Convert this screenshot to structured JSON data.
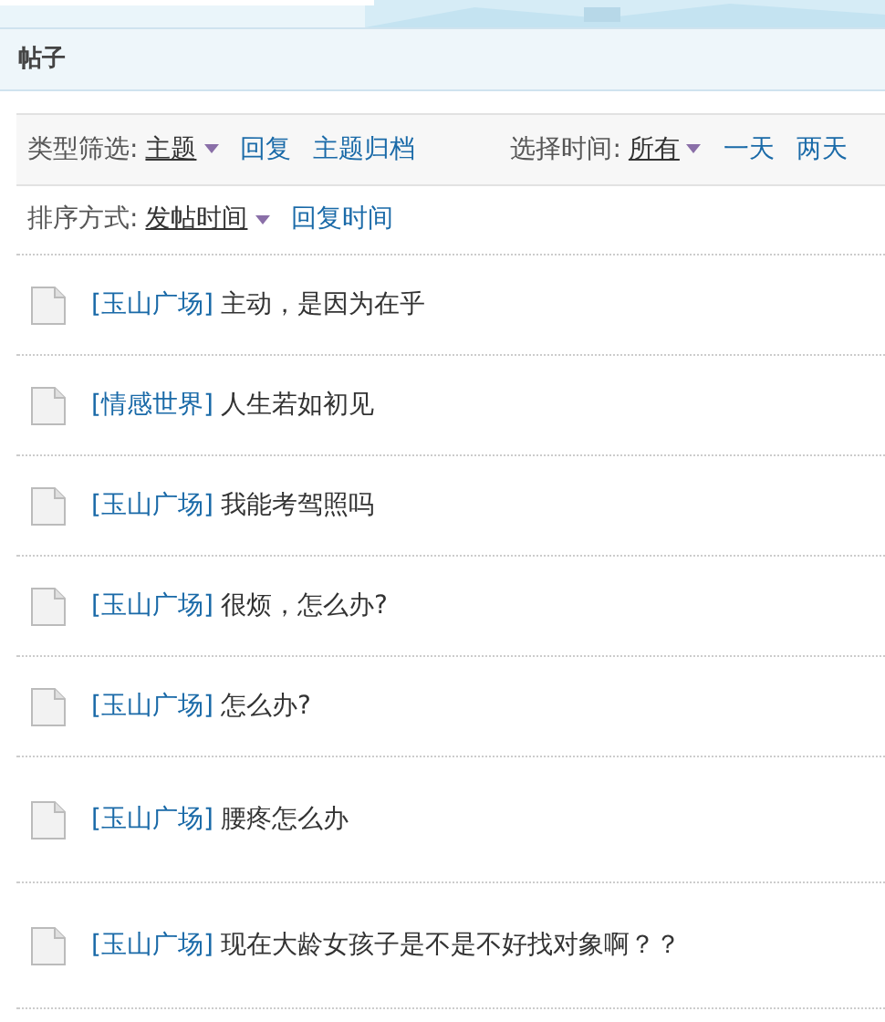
{
  "section": {
    "title": "帖子"
  },
  "type_filter": {
    "label": "类型筛选:",
    "options": [
      {
        "label": "主题",
        "selected": true
      },
      {
        "label": "回复",
        "selected": false
      },
      {
        "label": "主题归档",
        "selected": false
      }
    ]
  },
  "time_filter": {
    "label": "选择时间:",
    "options": [
      {
        "label": "所有",
        "selected": true
      },
      {
        "label": "一天",
        "selected": false
      },
      {
        "label": "两天",
        "selected": false
      }
    ]
  },
  "sort": {
    "label": "排序方式:",
    "options": [
      {
        "label": "发帖时间",
        "selected": true
      },
      {
        "label": "回复时间",
        "selected": false
      }
    ]
  },
  "posts": [
    {
      "category": "[玉山广场]",
      "title": "主动，是因为在乎",
      "tall": false
    },
    {
      "category": "[情感世界]",
      "title": "人生若如初见",
      "tall": false
    },
    {
      "category": "[玉山广场]",
      "title": "我能考驾照吗",
      "tall": false
    },
    {
      "category": "[玉山广场]",
      "title": "很烦，怎么办?",
      "tall": false
    },
    {
      "category": "[玉山广场]",
      "title": "怎么办?",
      "tall": false
    },
    {
      "category": "[玉山广场]",
      "title": "腰疼怎么办",
      "tall": true
    },
    {
      "category": "[玉山广场]",
      "title": "现在大龄女孩子是不是不好找对象啊？？",
      "tall": true
    }
  ]
}
